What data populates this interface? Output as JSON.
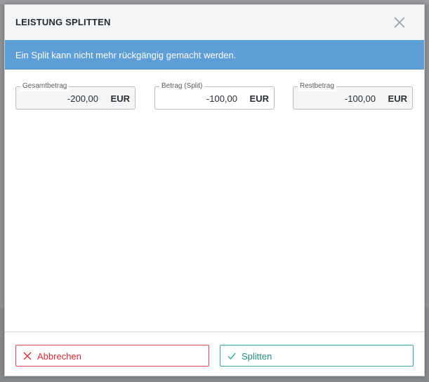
{
  "dialog": {
    "title": "LEISTUNG SPLITTEN",
    "info": "Ein Split kann nicht mehr rückgängig gemacht werden."
  },
  "fields": [
    {
      "label": "Gesamtbetrag",
      "value": "-200,00",
      "unit": "EUR"
    },
    {
      "label": "Betrag (Split)",
      "value": "-100,00",
      "unit": "EUR"
    },
    {
      "label": "Restbetrag",
      "value": "-100,00",
      "unit": "EUR"
    }
  ],
  "buttons": {
    "cancel_label": "Abbrechen",
    "split_label": "Splitten"
  },
  "icons": {
    "close": "close-icon",
    "cancel": "x-icon",
    "split": "check-icon"
  },
  "colors": {
    "info_bar": "#5e9ed6",
    "cancel": "#d42b35",
    "split": "#238b83"
  }
}
